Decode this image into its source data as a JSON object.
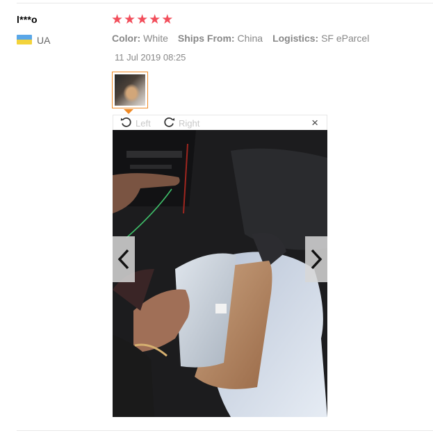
{
  "review": {
    "user_name": "l***o",
    "country_code": "UA",
    "flag_icon": "ukraine-flag-icon",
    "rating": 5,
    "rating_max": 5,
    "star_color": "#f24e5b",
    "attributes": [
      {
        "label": "Color:",
        "value": "White"
      },
      {
        "label": "Ships From:",
        "value": "China"
      },
      {
        "label": "Logistics:",
        "value": "SF eParcel"
      }
    ],
    "date": "11 Jul 2019 08:25"
  },
  "viewer": {
    "rotate_left_label": "Left",
    "rotate_right_label": "Right",
    "close_glyph": "×",
    "accent_color": "#f08a24",
    "icons": {
      "rotate_left": "rotate-left-icon",
      "rotate_right": "rotate-right-icon",
      "close": "close-icon",
      "prev": "chevron-left-icon",
      "next": "chevron-right-icon"
    }
  }
}
